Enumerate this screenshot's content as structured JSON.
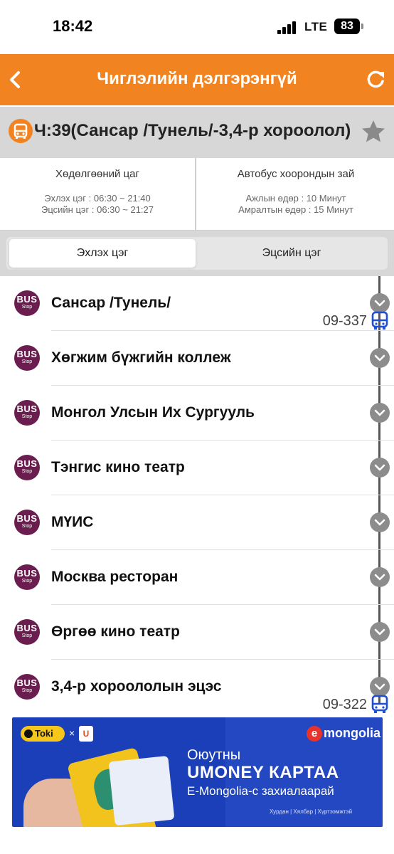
{
  "status_bar": {
    "time": "18:42",
    "network": "LTE",
    "battery": "83"
  },
  "header": {
    "title": "Чиглэлийн дэлгэрэнгүй",
    "back_icon": "chevron-left-icon",
    "refresh_icon": "refresh-icon"
  },
  "route": {
    "title": "Ч:39(Сансар /Тунель/-3,4-р хороолол)",
    "bus_icon": "bus-icon",
    "favorite_icon": "star-icon"
  },
  "info": {
    "hours_title": "Хөдөлгөөний цаг",
    "start_hours": "Эхлэх цэг : 06:30 ~ 21:40",
    "end_hours": "Эцсийн цэг : 06:30 ~ 21:27",
    "interval_title": "Автобус хоорондын зай",
    "weekday_interval": "Ажлын өдөр : 10 Минут",
    "weekend_interval": "Амралтын өдөр : 15 Минут"
  },
  "tabs": {
    "start": "Эхлэх цэг",
    "end": "Эцсийн цэг"
  },
  "stop_logo": {
    "line1": "BUS",
    "line2": "Stop"
  },
  "stops": [
    {
      "name": "Сансар /Тунель/",
      "bus": "09-337"
    },
    {
      "name": "Хөгжим бүжгийн коллеж"
    },
    {
      "name": "Монгол Улсын Их Сургууль"
    },
    {
      "name": "Тэнгис кино театр"
    },
    {
      "name": "МҮИС"
    },
    {
      "name": "Москва ресторан"
    },
    {
      "name": "Өргөө кино театр"
    },
    {
      "name": "3,4-р хороололын эцэс",
      "bus": "09-322"
    }
  ],
  "ad": {
    "toki": "Toki",
    "x": "×",
    "umoney_mark": "U",
    "brand": "mongolia",
    "brand_prefix": "e",
    "line1": "Оюутны",
    "line2": "UMONEY КАРТАА",
    "line3": "E-Mongolia-с захиалаарай",
    "footer": "Хурдан  |  Хялбар  |  Хүртээмжтэй"
  },
  "colors": {
    "accent": "#f28321",
    "stop_logo": "#6b1d4f",
    "bus_marker": "#1f4fd8"
  }
}
